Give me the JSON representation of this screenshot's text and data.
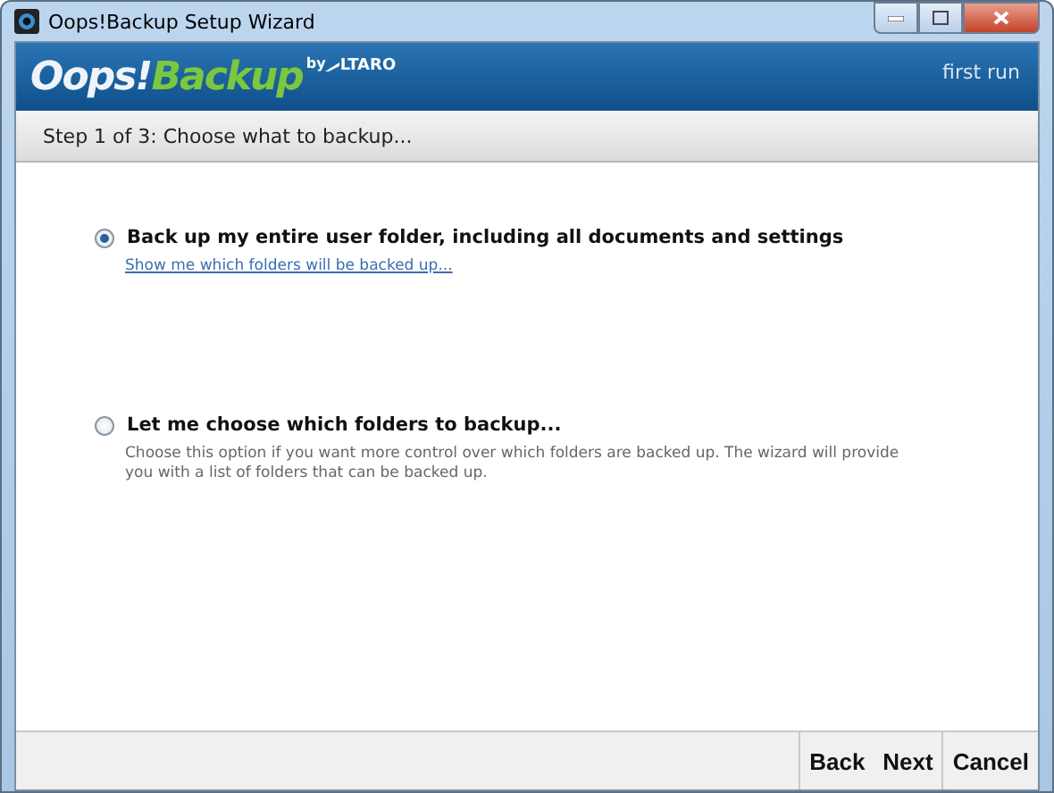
{
  "window": {
    "title": "Oops!Backup Setup Wizard"
  },
  "header": {
    "logo_main": "Oops!",
    "logo_accent": "Backup",
    "logo_by": "by",
    "logo_vendor": "LTARO",
    "mode": "first run"
  },
  "step": "Step 1 of 3: Choose what to backup...",
  "options": [
    {
      "label": "Back up my entire user folder, including all documents and settings",
      "selected": true,
      "link": "Show me which folders will be backed up..."
    },
    {
      "label": "Let me choose which folders to backup...",
      "selected": false,
      "description": "Choose this option if you want more control over which folders are backed up.  The wizard will provide you with a list of folders that can be backed up."
    }
  ],
  "buttons": [
    "Back",
    "Next",
    "Cancel"
  ]
}
